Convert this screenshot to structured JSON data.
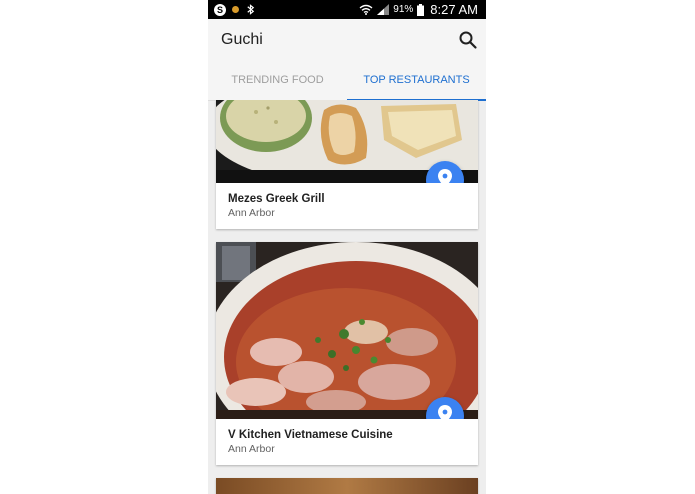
{
  "status_bar": {
    "battery_percent": "91%",
    "time": "8:27 AM",
    "icons": [
      "skype-icon",
      "notification-dot-icon",
      "bluetooth-icon",
      "wifi-icon",
      "signal-icon",
      "battery-icon"
    ]
  },
  "app": {
    "title": "Guchi",
    "search_icon": "search-icon"
  },
  "tabs": [
    {
      "label": "TRENDING FOOD",
      "active": false
    },
    {
      "label": "TOP RESTAURANTS",
      "active": true
    }
  ],
  "restaurants": [
    {
      "name": "Mezes Greek Grill",
      "city": "Ann Arbor",
      "action_icon": "location-pin-icon"
    },
    {
      "name": "V Kitchen Vietnamese Cuisine",
      "city": "Ann Arbor",
      "action_icon": "location-pin-icon"
    }
  ],
  "colors": {
    "accent": "#1e6fd0",
    "fab": "#3b82f1",
    "status_bar": "#000000",
    "app_bar": "#f5f5f5"
  }
}
